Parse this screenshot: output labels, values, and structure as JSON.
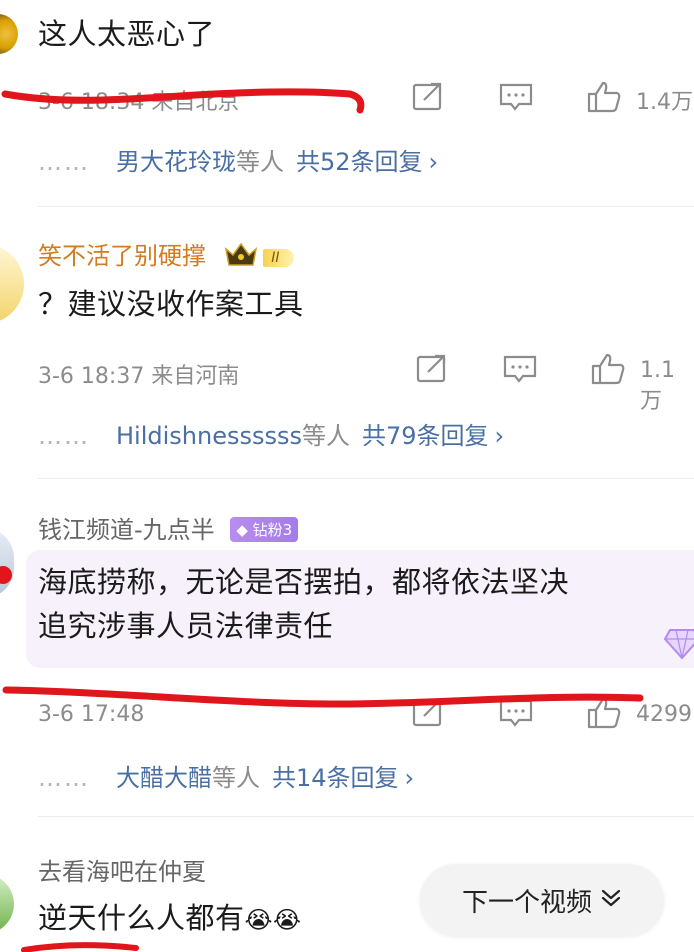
{
  "comments": [
    {
      "content": "这人太恶心了",
      "meta": "3-6 18:34 来自北京",
      "likes": "1.4万",
      "reply_who": "男大花玲珑",
      "reply_suffix": "等人",
      "reply_total": "共52条回复",
      "reply_chev": "›"
    },
    {
      "username": "笑不活了别硬撑",
      "badge": "II",
      "content": "？建议没收作案工具",
      "meta": "3-6 18:37 来自河南",
      "likes": "1.1万",
      "reply_who": "Hildishnessssss",
      "reply_suffix": "等人",
      "reply_total": "共79条回复",
      "reply_chev": "›"
    },
    {
      "username": "钱江频道-九点半",
      "badge": "钻粉3",
      "content_line1": "海底捞称，无论是否摆拍，都将依法坚决",
      "content_line2": "追究涉事人员法律责任",
      "meta": "3-6 17:48",
      "likes": "4299",
      "reply_who": "大醋大醋",
      "reply_suffix": "等人",
      "reply_total": "共14条回复",
      "reply_chev": "›"
    },
    {
      "username": "去看海吧在仲夏",
      "content": "逆天什么人都有",
      "emoji": "😭😭"
    }
  ],
  "next_video": {
    "label": "下一个视频",
    "chevron_icon": "chevron-down-icon"
  },
  "colors": {
    "link": "#4a6fa5",
    "meta": "#8c8c8c",
    "annotation": "#e0161c",
    "highlight_bg": "#f6f1fb"
  },
  "icons": [
    "share-icon",
    "comment-icon",
    "like-icon"
  ]
}
